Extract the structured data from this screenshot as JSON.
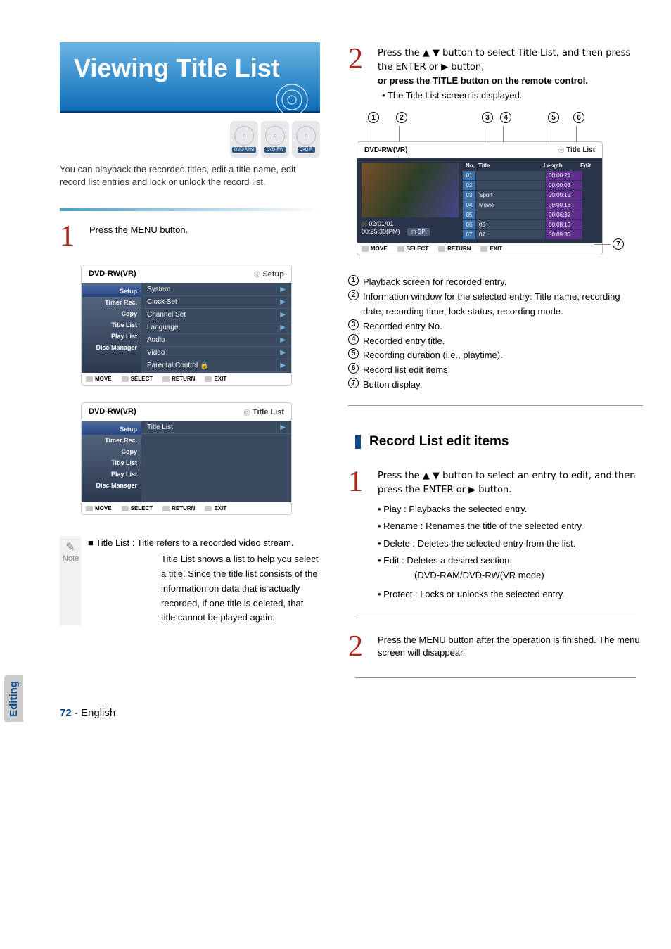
{
  "banner": {
    "title": "Viewing Title List"
  },
  "disc_labels": [
    "DVD-RAM",
    "DVD-RW",
    "DVD-R"
  ],
  "intro": "You can playback the recorded titles, edit a title name, edit record list entries and lock or unlock the record list.",
  "left": {
    "step1_text": "Press the MENU button."
  },
  "osd1": {
    "head_left": "DVD-RW(VR)",
    "head_right": "Setup",
    "side": [
      "Setup",
      "Timer Rec.",
      "Copy",
      "Title List",
      "Play List",
      "Disc Manager"
    ],
    "rows": [
      "System",
      "Clock Set",
      "Channel Set",
      "Language",
      "Audio",
      "Video",
      "Parental Control"
    ],
    "foot": [
      "MOVE",
      "SELECT",
      "RETURN",
      "EXIT"
    ]
  },
  "osd2": {
    "head_left": "DVD-RW(VR)",
    "head_right": "Title List",
    "side": [
      "Setup",
      "Timer Rec.",
      "Copy",
      "Title List",
      "Play List",
      "Disc Manager"
    ],
    "rows": [
      "Title List"
    ],
    "foot": [
      "MOVE",
      "SELECT",
      "RETURN",
      "EXIT"
    ]
  },
  "note": {
    "label": "Note",
    "bullet": "■",
    "text_lead": "Title List : Title refers to a recorded video stream.",
    "text_body": "Title List shows a list to help you select a title. Since the title list consists of the information on data that is actually recorded, if one title is deleted, that title cannot be played again."
  },
  "right": {
    "step2a": "Press the ▲ ▼ button to select Title List, and then press the ENTER or ▶ button,",
    "step2b": "or press the TITLE button on the remote control.",
    "step2c": "The Title List screen is displayed."
  },
  "tl": {
    "head_left": "DVD-RW(VR)",
    "head_right": "Title List",
    "date": "02/01/01",
    "time": "00:25:30(PM)",
    "sp": "SP",
    "hdr": {
      "no": "No.",
      "title": "Title",
      "length": "Length",
      "edit": "Edit"
    },
    "rows": [
      {
        "no": "01",
        "title": "",
        "len": "00:00:21"
      },
      {
        "no": "02",
        "title": "",
        "len": "00:00:03"
      },
      {
        "no": "03",
        "title": "Sport",
        "len": "00:00:15"
      },
      {
        "no": "04",
        "title": "Movie",
        "len": "00:00:18"
      },
      {
        "no": "05",
        "title": "",
        "len": "00:06:32"
      },
      {
        "no": "06",
        "title": "06",
        "len": "00:08:16"
      },
      {
        "no": "07",
        "title": "07",
        "len": "00:09:36"
      }
    ],
    "foot": [
      "MOVE",
      "SELECT",
      "RETURN",
      "EXIT"
    ]
  },
  "legend": [
    "Playback screen for recorded entry.",
    "Information window for the selected entry: Title name, recording date, recording time, lock status, recording mode.",
    "Recorded entry No.",
    "Recorded entry title.",
    "Recording duration (i.e., playtime).",
    "Record list edit items.",
    "Button display."
  ],
  "section": {
    "title": "Record List edit items"
  },
  "edit_step1": "Press the ▲ ▼ button to select an entry to edit, and then press the ENTER or ▶ button.",
  "edit_items": [
    "Play : Playbacks the selected entry.",
    "Rename : Renames the title of the selected entry.",
    "Delete : Deletes the selected entry from the list.",
    "Edit : Deletes a desired section.",
    "Protect : Locks or unlocks the selected entry."
  ],
  "edit_sub": "(DVD-RAM/DVD-RW(VR mode)",
  "edit_step2": "Press the MENU button after the operation is finished. The menu screen will disappear.",
  "side_tab": "Editing",
  "footer": {
    "page": "72",
    "dash": "-",
    "lang": "English"
  },
  "calls": {
    "c1": "1",
    "c2": "2",
    "c3": "3",
    "c4": "4",
    "c5": "5",
    "c6": "6",
    "c7": "7"
  }
}
